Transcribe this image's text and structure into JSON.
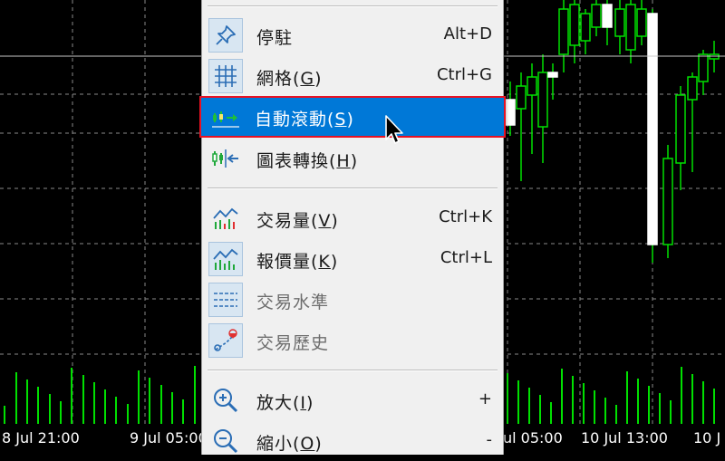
{
  "chart": {
    "time_labels": [
      "8 Jul 21:00",
      "9 Jul 05:00",
      "ul 05:00",
      "10 Jul 13:00",
      "10 J"
    ],
    "colors": {
      "background": "#000000",
      "candle": "#00e000",
      "volume": "#00e000",
      "grid": "#8a8a8a",
      "bid_line": "#c8c8c8"
    }
  },
  "menu": {
    "items": [
      {
        "icon": "pin-icon",
        "label": "停駐",
        "mnemonic": "",
        "shortcut": "Alt+D",
        "checked": true,
        "enabled": true
      },
      {
        "icon": "grid-icon",
        "label": "網格(",
        "mnemonic": "G",
        "label_end": ")",
        "shortcut": "Ctrl+G",
        "checked": true,
        "enabled": true
      },
      {
        "icon": "auto-scroll-icon",
        "label": "自動滾動(",
        "mnemonic": "S",
        "label_end": ")",
        "shortcut": "",
        "checked": true,
        "enabled": true,
        "highlighted": true
      },
      {
        "icon": "chart-shift-icon",
        "label": "圖表轉換(",
        "mnemonic": "H",
        "label_end": ")",
        "shortcut": "",
        "checked": false,
        "enabled": true
      },
      {
        "icon": "volumes-icon",
        "label": "交易量(",
        "mnemonic": "V",
        "label_end": ")",
        "shortcut": "Ctrl+K",
        "checked": false,
        "enabled": true
      },
      {
        "icon": "tick-volumes-icon",
        "label": "報價量(",
        "mnemonic": "K",
        "label_end": ")",
        "shortcut": "Ctrl+L",
        "checked": true,
        "enabled": true
      },
      {
        "icon": "trade-levels-icon",
        "label": "交易水準",
        "mnemonic": "",
        "shortcut": "",
        "checked": true,
        "enabled": false
      },
      {
        "icon": "trade-history-icon",
        "label": "交易歷史",
        "mnemonic": "",
        "shortcut": "",
        "checked": true,
        "enabled": false
      },
      {
        "icon": "zoom-in-icon",
        "label": "放大(",
        "mnemonic": "I",
        "label_end": ")",
        "shortcut": "+",
        "checked": false,
        "enabled": true
      },
      {
        "icon": "zoom-out-icon",
        "label": "縮小(",
        "mnemonic": "O",
        "label_end": ")",
        "shortcut": "-",
        "checked": false,
        "enabled": true
      }
    ]
  }
}
